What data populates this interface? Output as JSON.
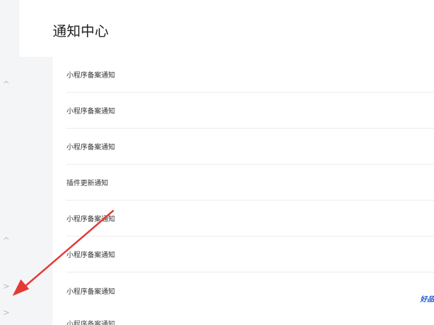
{
  "page": {
    "title": "通知中心",
    "right_edge_text": "好品"
  },
  "sidebar_arrows": {
    "up_1": "^",
    "up_2": "^",
    "right_1": ">",
    "right_2": ">"
  },
  "notices": [
    {
      "label": "小程序备案通知"
    },
    {
      "label": "小程序备案通知"
    },
    {
      "label": "小程序备案通知"
    },
    {
      "label": "插件更新通知"
    },
    {
      "label": "小程序备案通知"
    },
    {
      "label": "小程序备案通知"
    },
    {
      "label": "小程序备案通知"
    }
  ],
  "partial_next_label": "小程序备案通知",
  "colors": {
    "background": "#f4f5f7",
    "panel": "#ffffff",
    "divider": "#e9ebef",
    "annotation_arrow": "#e53935",
    "right_edge_text": "#1a5ad8"
  }
}
